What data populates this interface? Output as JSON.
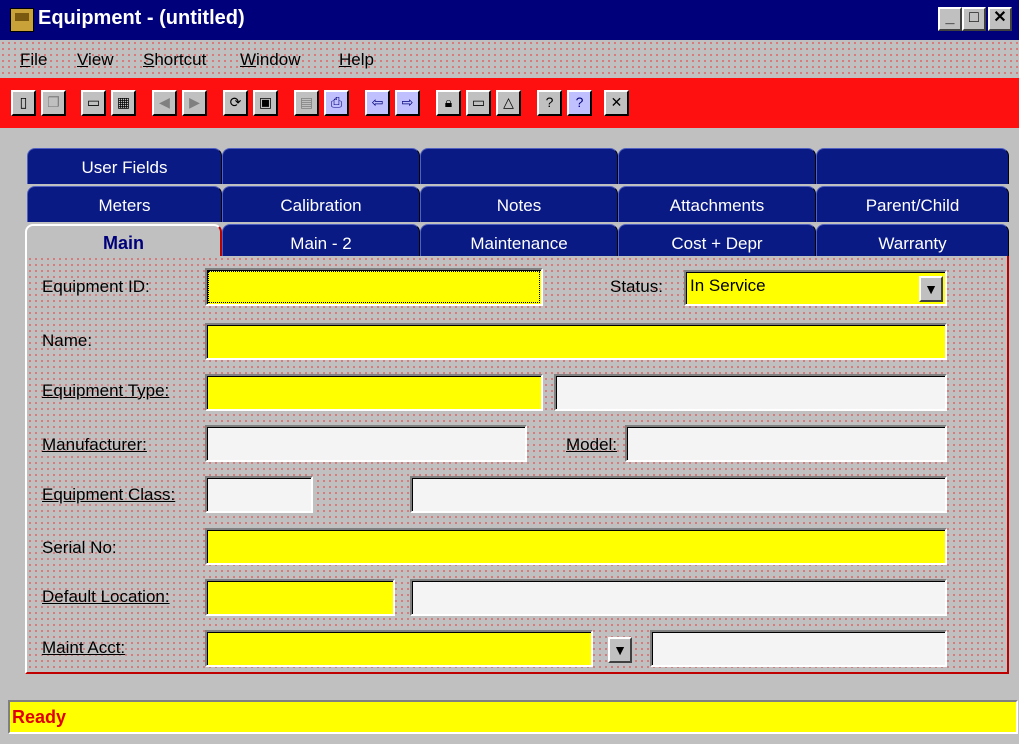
{
  "window": {
    "title": "Equipment - (untitled)"
  },
  "menu": {
    "items": [
      "File",
      "View",
      "Shortcut",
      "Window",
      "Help"
    ]
  },
  "toolbar": {
    "icons": [
      "new-doc-icon",
      "copy-doc-icon",
      "open-folder-icon",
      "save-grid-icon",
      "prev-record-icon",
      "next-record-icon",
      "refresh-icon",
      "save-disk-icon",
      "print-preview-icon",
      "print-icon",
      "link-left-icon",
      "link-right-icon",
      "lock-icon",
      "folder-open-icon",
      "shapes-icon",
      "help-icon",
      "context-help-icon",
      "close-icon"
    ]
  },
  "tabs": {
    "row1": [
      "User Fields",
      "",
      "",
      "",
      ""
    ],
    "row2": [
      "Meters",
      "Calibration",
      "Notes",
      "Attachments",
      "Parent/Child"
    ],
    "row3": [
      "Main",
      "Main - 2",
      "Maintenance",
      "Cost + Depr",
      "Warranty"
    ],
    "active": "Main"
  },
  "form": {
    "equipment_id_label": "Equipment ID:",
    "status_label": "Status:",
    "status_value": "In Service",
    "name_label": "Name:",
    "equipment_type_label": "Equipment Type:",
    "manufacturer_label": "Manufacturer:",
    "model_label": "Model:",
    "equipment_class_label": "Equipment Class:",
    "serial_no_label": "Serial No:",
    "default_location_label": "Default Location:",
    "maint_acct_label": "Maint Acct:"
  },
  "status_bar": {
    "text": "Ready"
  },
  "colors": {
    "title_bar": "#00007b",
    "toolbar": "#ff1010",
    "required_field": "#ffff00",
    "tab": "#0a1a84"
  }
}
